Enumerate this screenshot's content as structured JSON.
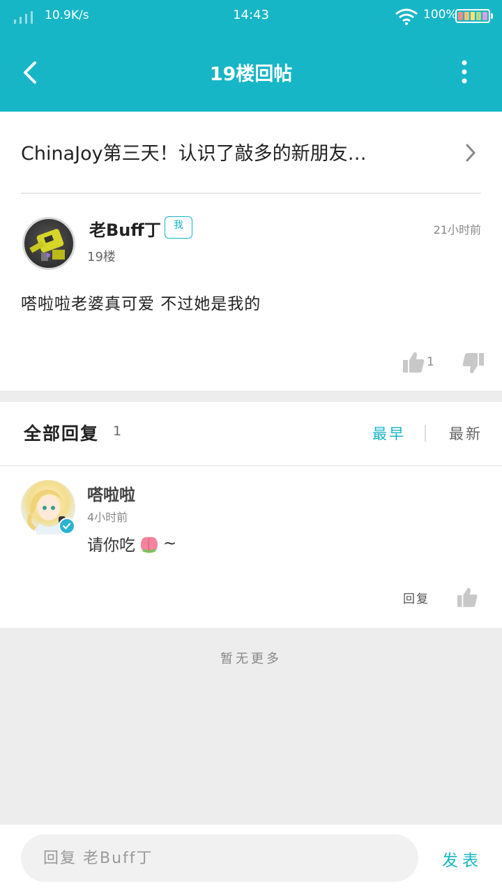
{
  "status_bar": {
    "net_speed": "10.9K/s",
    "time": "14:43",
    "battery_percent": "100%"
  },
  "app_bar": {
    "title": "19楼回帖",
    "back_icon": "back-arrow-icon",
    "more_icon": "more-vertical-icon"
  },
  "post": {
    "thread_title": "ChinaJoy第三天！认识了敲多的新朋友…",
    "author": "老Buff丁",
    "me_badge": "我",
    "floor": "19楼",
    "time": "21小时前",
    "content": "嗒啦啦老婆真可爱 不过她是我的",
    "like_count": "1"
  },
  "replies": {
    "header_title": "全部回复",
    "count": "1",
    "sort_old": "最早",
    "sort_new": "最新",
    "items": [
      {
        "name": "嗒啦啦",
        "time": "4小时前",
        "text": "请你吃",
        "suffix": "~",
        "reply_label": "回复"
      }
    ]
  },
  "no_more": "暂无更多",
  "bottom_bar": {
    "input_placeholder": "回复 老Buff丁",
    "send_label": "发表"
  },
  "colors": {
    "accent": "#17b6c6",
    "page_bg": "#ededed"
  }
}
